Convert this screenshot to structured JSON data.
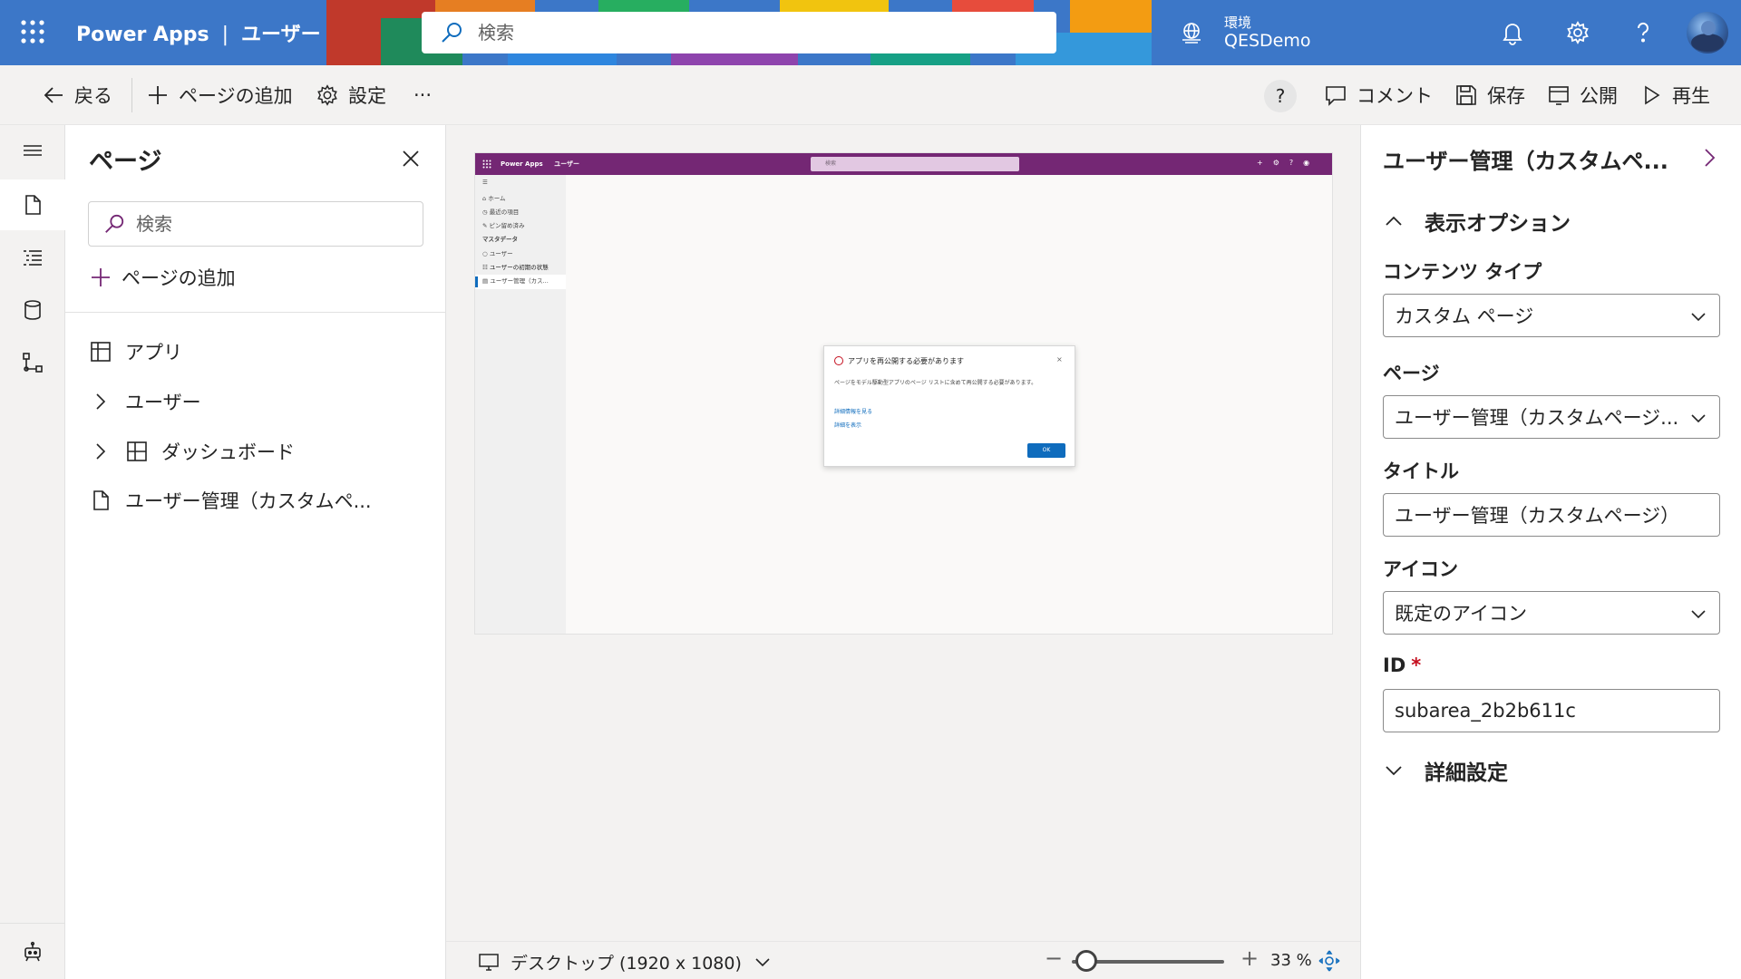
{
  "header": {
    "app_name": "Power Apps",
    "separator": "|",
    "app_title": "ユーザー",
    "search_placeholder": "検索",
    "environment_label": "環境",
    "environment_name": "QESDemo"
  },
  "commandbar": {
    "back": "戻る",
    "add_page": "ページの追加",
    "settings": "設定",
    "more": "···",
    "help": "?",
    "comment": "コメント",
    "save": "保存",
    "publish": "公開",
    "play": "再生"
  },
  "pages_panel": {
    "title": "ページ",
    "search_placeholder": "検索",
    "add_page": "ページの追加",
    "items": [
      {
        "label": "アプリ",
        "icon": "app-icon"
      },
      {
        "label": "ユーザー",
        "icon": "chevron-right-icon"
      },
      {
        "label": "ダッシュボード",
        "icon": "dashboard-icon"
      },
      {
        "label": "ユーザー管理（カスタムペ...",
        "icon": "page-icon"
      }
    ]
  },
  "preview": {
    "brand": "Power Apps",
    "app_title": "ユーザー",
    "search_placeholder": "検索",
    "nav": [
      "ホーム",
      "最近の項目",
      "ピン留め済み",
      "マスタデータ",
      "ユーザー",
      "ユーザーの初期の状態",
      "ユーザー管理（カス..."
    ],
    "dialog": {
      "title": "アプリを再公開する必要があります",
      "body": "ページをモデル駆動型アプリのページ リストに含めて再公開する必要があります。",
      "link1": "詳細情報を見る",
      "link2": "詳細を表示",
      "ok": "OK",
      "close": "×"
    }
  },
  "canvas_footer": {
    "device": "デスクトップ (1920 x 1080)",
    "zoom_minus": "−",
    "zoom_plus": "+",
    "zoom_value": "33 %",
    "zoom_percent": 33
  },
  "properties": {
    "title": "ユーザー管理（カスタムペ...",
    "section_display": "表示オプション",
    "content_type_label": "コンテンツ タイプ",
    "content_type_value": "カスタム ページ",
    "page_label": "ページ",
    "page_value": "ユーザー管理（カスタムページ...",
    "title_label": "タイトル",
    "title_value": "ユーザー管理（カスタムページ）",
    "icon_label": "アイコン",
    "icon_value": "既定のアイコン",
    "id_label": "ID",
    "id_required": "*",
    "id_value": "subarea_2b2b611c",
    "section_advanced": "詳細設定"
  },
  "colors": {
    "header_blue": "#3c77c8",
    "preview_purple": "#742774",
    "accent_blue": "#0f6cbd",
    "required_red": "#c50f1f"
  }
}
